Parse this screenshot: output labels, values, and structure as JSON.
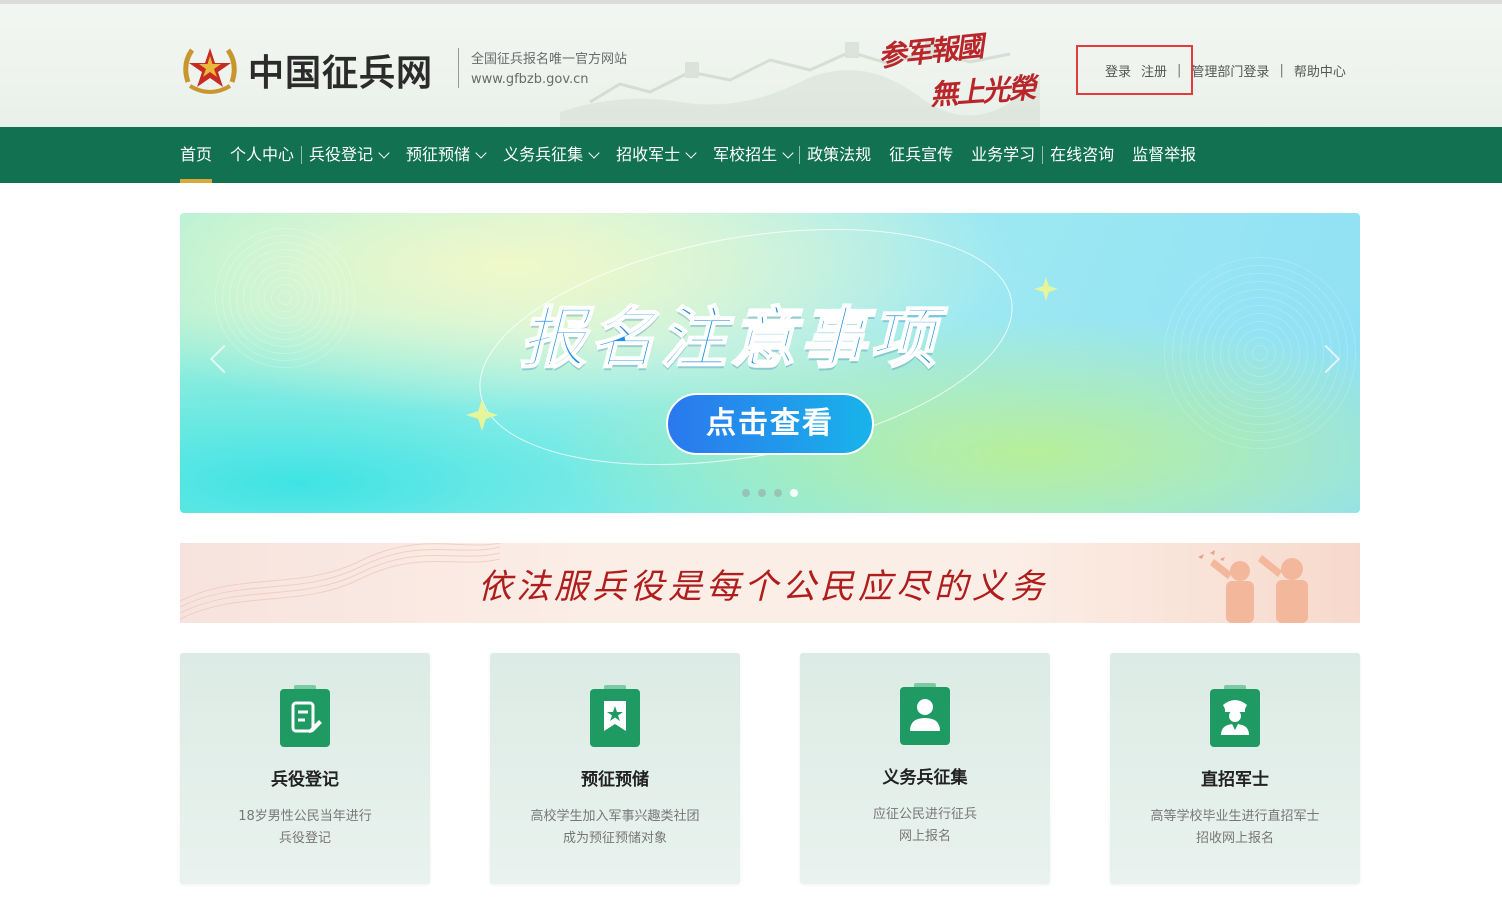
{
  "header": {
    "site_name": "中国征兵网",
    "slogan_line1": "全国征兵报名唯一官方网站",
    "slogan_line2": "www.gfbzb.gov.cn",
    "calligraphy_line1": "参军報國",
    "calligraphy_line2": "無上光榮",
    "login": "登录",
    "register": "注册",
    "admin_login": "管理部门登录",
    "help_center": "帮助中心"
  },
  "nav": {
    "items": [
      {
        "label": "首页"
      },
      {
        "label": "个人中心"
      },
      {
        "label": "兵役登记"
      },
      {
        "label": "预征预储"
      },
      {
        "label": "义务兵征集"
      },
      {
        "label": "招收军士"
      },
      {
        "label": "军校招生"
      },
      {
        "label": "政策法规"
      },
      {
        "label": "征兵宣传"
      },
      {
        "label": "业务学习"
      },
      {
        "label": "在线咨询"
      },
      {
        "label": "监督举报"
      }
    ],
    "active_index": 0
  },
  "banner": {
    "title": "报名注意事项",
    "button": "点击查看",
    "slide_count": 4,
    "active_slide": 3
  },
  "strip": {
    "text": "依法服兵役是每个公民应尽的义务"
  },
  "cards": [
    {
      "title": "兵役登记",
      "desc_line1": "18岁男性公民当年进行",
      "desc_line2": "兵役登记",
      "icon": "document-edit-icon"
    },
    {
      "title": "预征预储",
      "desc_line1": "高校学生加入军事兴趣类社团",
      "desc_line2": "成为预征预储对象",
      "icon": "star-bookmark-icon"
    },
    {
      "title": "义务兵征集",
      "desc_line1": "应征公民进行征兵",
      "desc_line2": "网上报名",
      "icon": "person-badge-icon"
    },
    {
      "title": "直招军士",
      "desc_line1": "高等学校毕业生进行直招军士",
      "desc_line2": "招收网上报名",
      "icon": "soldier-icon"
    }
  ],
  "colors": {
    "nav_bg": "#127151",
    "nav_active_underline": "#d8a838",
    "highlight_box": "#e23b3b",
    "card_icon": "#1f9a63",
    "strip_text": "#b01d1d"
  }
}
